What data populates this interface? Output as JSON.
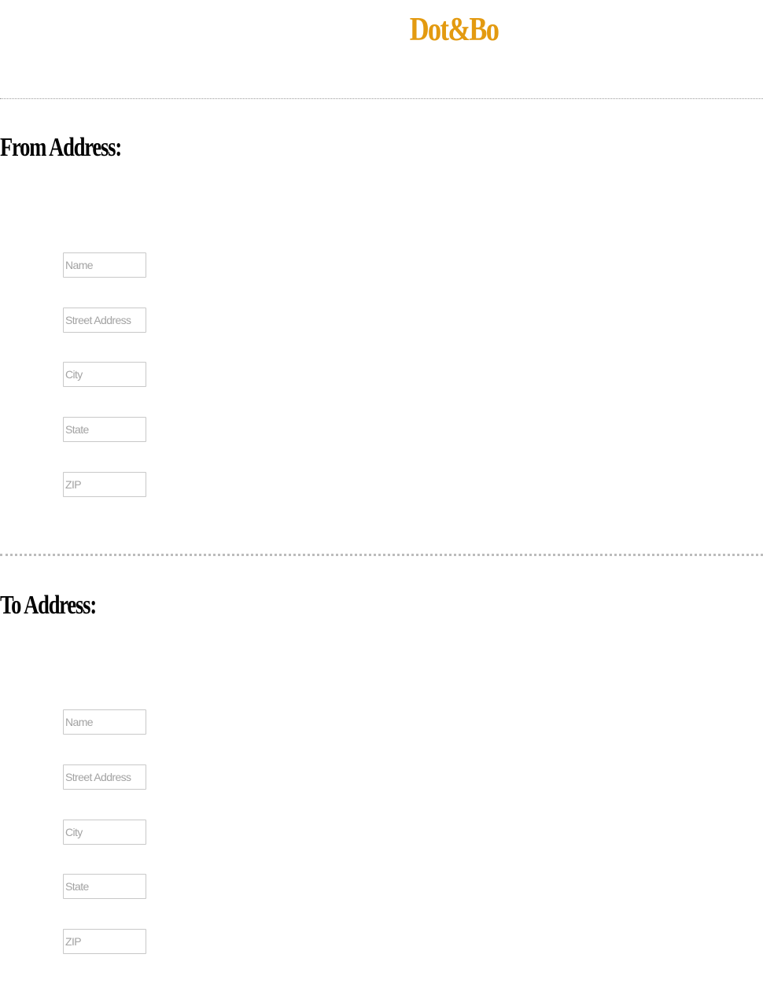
{
  "header": {
    "logo_text": "Dot&Bo",
    "logo_color": "#e39a10"
  },
  "from_section": {
    "title": "From Address:",
    "fields": [
      {
        "placeholder": "Name",
        "value": ""
      },
      {
        "placeholder": "Street Address",
        "value": ""
      },
      {
        "placeholder": "City",
        "value": ""
      },
      {
        "placeholder": "State",
        "value": ""
      },
      {
        "placeholder": "ZIP",
        "value": ""
      }
    ]
  },
  "to_section": {
    "title": "To Address:",
    "fields": [
      {
        "placeholder": "Name",
        "value": ""
      },
      {
        "placeholder": "Street Address",
        "value": ""
      },
      {
        "placeholder": "City",
        "value": ""
      },
      {
        "placeholder": "State",
        "value": ""
      },
      {
        "placeholder": "ZIP",
        "value": ""
      }
    ]
  }
}
